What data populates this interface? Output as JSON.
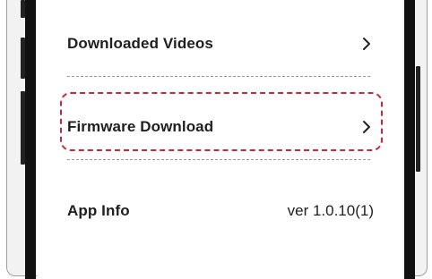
{
  "settings": {
    "items": [
      {
        "label": "Downloaded Videos",
        "trailing": "chevron-right-icon"
      },
      {
        "label": "Firmware Download",
        "trailing": "chevron-right-icon",
        "highlighted": true
      },
      {
        "label": "App Info",
        "value": "ver 1.0.10(1)"
      }
    ]
  },
  "colors": {
    "highlight_border": "#c8283c",
    "divider": "#9a9a9a",
    "bezel": "#111111"
  }
}
